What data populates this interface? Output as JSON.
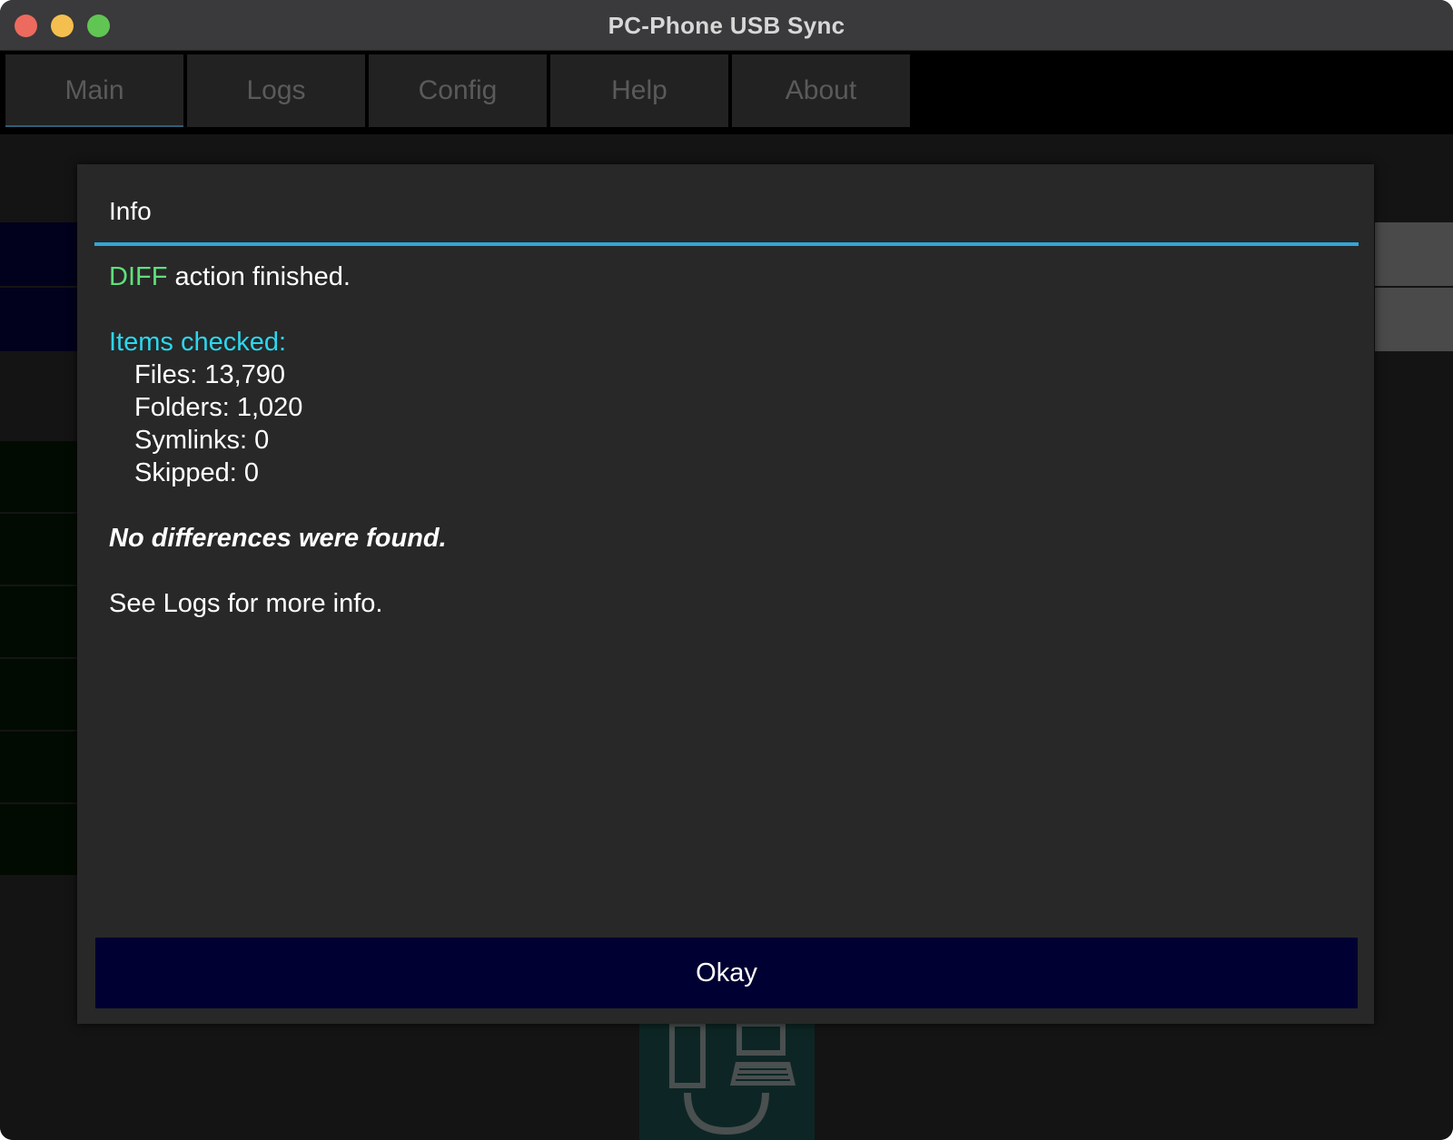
{
  "window": {
    "title": "PC-Phone USB Sync"
  },
  "tabs": [
    {
      "label": "Main",
      "active": true
    },
    {
      "label": "Logs",
      "active": false
    },
    {
      "label": "Config",
      "active": false
    },
    {
      "label": "Help",
      "active": false
    },
    {
      "label": "About",
      "active": false
    }
  ],
  "dialog": {
    "title": "Info",
    "action_keyword": "DIFF",
    "action_suffix": " action finished.",
    "items_heading": "Items checked:",
    "stats": [
      {
        "text": "Files: 13,790"
      },
      {
        "text": "Folders: 1,020"
      },
      {
        "text": "Symlinks: 0"
      },
      {
        "text": "Skipped: 0"
      }
    ],
    "result": "No differences were found.",
    "footer_note": "See Logs for more info.",
    "okay_label": "Okay"
  },
  "colors": {
    "accent": "#33a5d8",
    "action_keyword": "#5fe07a",
    "heading": "#2bd7ee",
    "button_bg": "#000032"
  },
  "icons": {
    "usb_sync": "phone-computer-usb-icon"
  }
}
